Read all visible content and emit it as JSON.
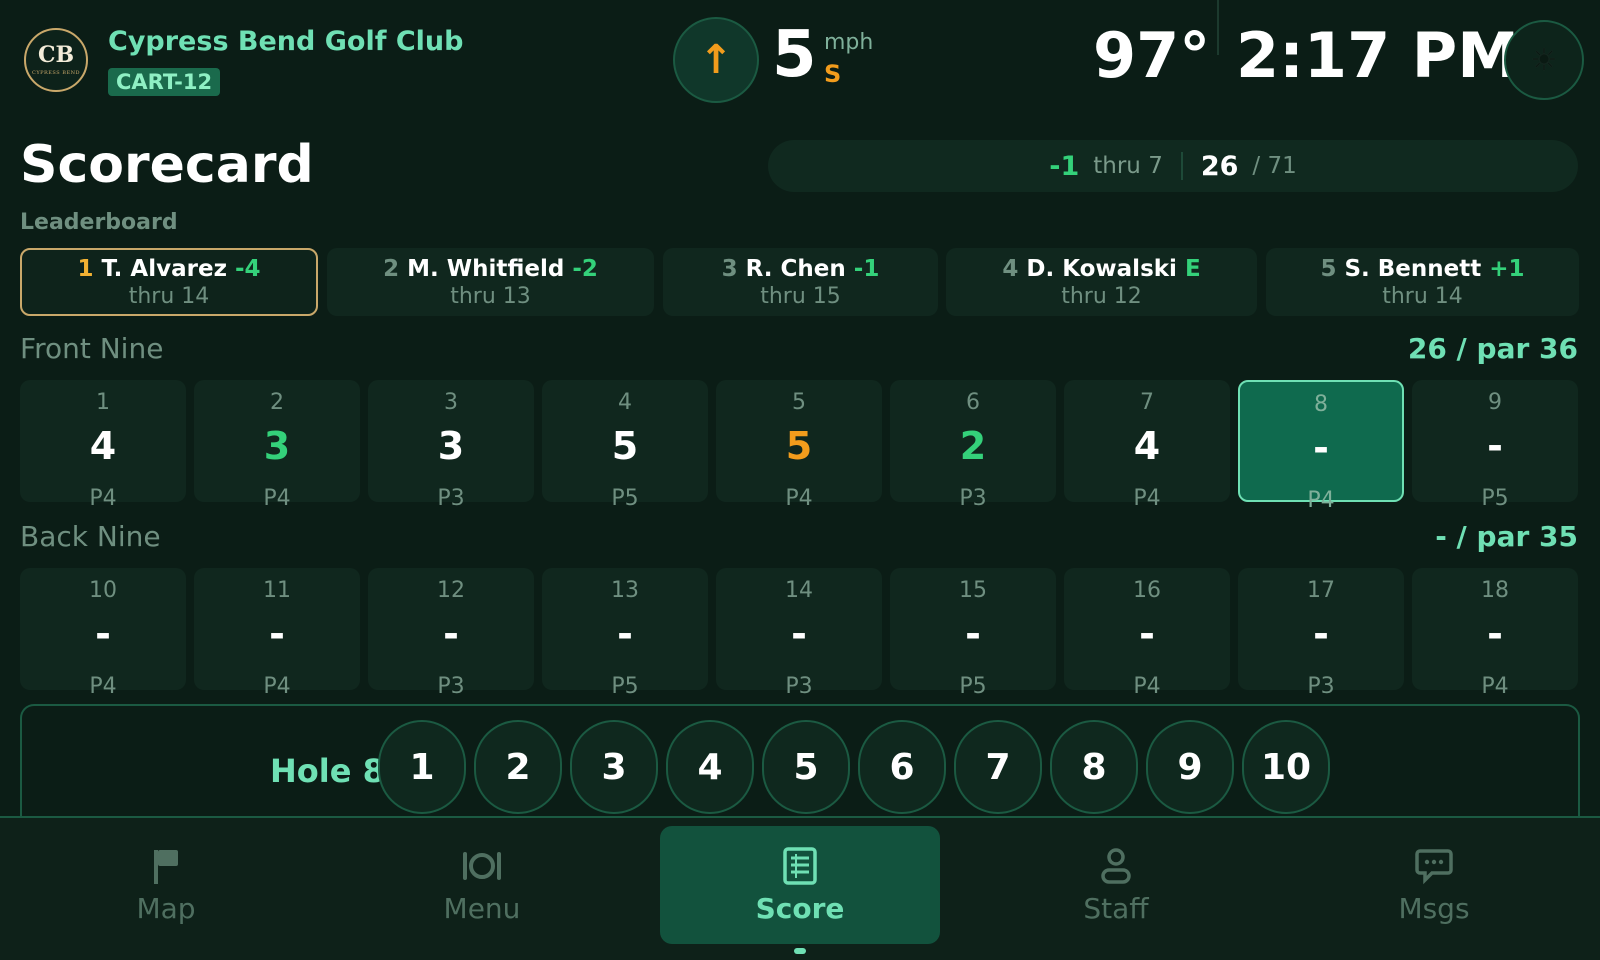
{
  "header": {
    "logo_monogram": "CB",
    "logo_subtext": "CYPRESS BEND",
    "club_name": "Cypress Bend Golf Club",
    "cart_id": "CART-12",
    "wind": {
      "arrow": "↑",
      "speed": "5",
      "unit": "mph",
      "direction": "S"
    },
    "temperature": "97°",
    "time": "2:17 PM",
    "theme_icon": "sun-icon"
  },
  "page": {
    "title": "Scorecard"
  },
  "summary": {
    "to_par": "-1",
    "thru": "thru 7",
    "strokes": "26",
    "par": "/ 71"
  },
  "leaderboard": {
    "label": "Leaderboard",
    "players": [
      {
        "rank": "1",
        "name": "T. Alvarez",
        "score": "-4",
        "thru": "thru 14",
        "active": true
      },
      {
        "rank": "2",
        "name": "M. Whitfield",
        "score": "-2",
        "thru": "thru 13",
        "active": false
      },
      {
        "rank": "3",
        "name": "R. Chen",
        "score": "-1",
        "thru": "thru 15",
        "active": false
      },
      {
        "rank": "4",
        "name": "D. Kowalski",
        "score": "E",
        "thru": "thru 12",
        "active": false
      },
      {
        "rank": "5",
        "name": "S. Bennett",
        "score": "+1",
        "thru": "thru 14",
        "active": false
      }
    ]
  },
  "front_nine": {
    "title": "Front Nine",
    "total": "26 / par 36",
    "holes": [
      {
        "num": "1",
        "score": "4",
        "par": "P4",
        "state": "even"
      },
      {
        "num": "2",
        "score": "3",
        "par": "P4",
        "state": "good"
      },
      {
        "num": "3",
        "score": "3",
        "par": "P3",
        "state": "even"
      },
      {
        "num": "4",
        "score": "5",
        "par": "P5",
        "state": "even"
      },
      {
        "num": "5",
        "score": "5",
        "par": "P4",
        "state": "bad"
      },
      {
        "num": "6",
        "score": "2",
        "par": "P3",
        "state": "good"
      },
      {
        "num": "7",
        "score": "4",
        "par": "P4",
        "state": "even"
      },
      {
        "num": "8",
        "score": "-",
        "par": "P4",
        "state": "current"
      },
      {
        "num": "9",
        "score": "-",
        "par": "P5",
        "state": "empty"
      }
    ]
  },
  "back_nine": {
    "title": "Back Nine",
    "total": "- / par 35",
    "holes": [
      {
        "num": "10",
        "score": "-",
        "par": "P4",
        "state": "empty"
      },
      {
        "num": "11",
        "score": "-",
        "par": "P4",
        "state": "empty"
      },
      {
        "num": "12",
        "score": "-",
        "par": "P3",
        "state": "empty"
      },
      {
        "num": "13",
        "score": "-",
        "par": "P5",
        "state": "empty"
      },
      {
        "num": "14",
        "score": "-",
        "par": "P3",
        "state": "empty"
      },
      {
        "num": "15",
        "score": "-",
        "par": "P5",
        "state": "empty"
      },
      {
        "num": "16",
        "score": "-",
        "par": "P4",
        "state": "empty"
      },
      {
        "num": "17",
        "score": "-",
        "par": "P3",
        "state": "empty"
      },
      {
        "num": "18",
        "score": "-",
        "par": "P4",
        "state": "empty"
      }
    ]
  },
  "entry": {
    "label": "Hole 8",
    "options": [
      "1",
      "2",
      "3",
      "4",
      "5",
      "6",
      "7",
      "8",
      "9",
      "10"
    ]
  },
  "nav": {
    "items": [
      {
        "label": "Map",
        "icon": "flag-icon",
        "active": false
      },
      {
        "label": "Menu",
        "icon": "plate-icon",
        "active": false
      },
      {
        "label": "Score",
        "icon": "scorecard-icon",
        "active": true
      },
      {
        "label": "Staff",
        "icon": "person-icon",
        "active": false
      },
      {
        "label": "Msgs",
        "icon": "chat-icon",
        "active": false
      }
    ]
  },
  "colors": {
    "background": "#0b1d16",
    "accent": "#6fe0b4",
    "under_par": "#34d17a",
    "over_par": "#f29c1c",
    "leader_border": "#c9a86a"
  }
}
